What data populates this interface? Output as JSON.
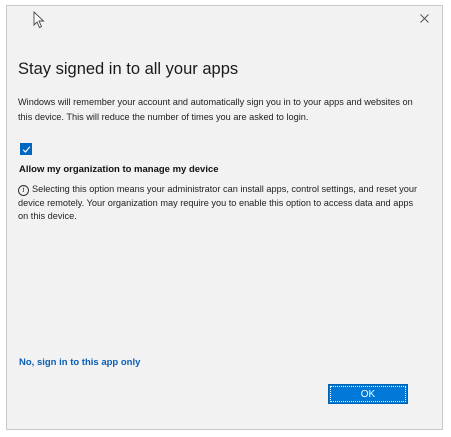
{
  "dialog": {
    "title": "Stay signed in to all your apps",
    "description": "Windows will remember your account and automatically sign you in to your apps and websites on this device. This will reduce the number of times you are asked to login.",
    "checkbox": {
      "checked": true,
      "label": "Allow my organization to manage my device"
    },
    "info_text": "Selecting this option means your administrator can install apps, control settings, and reset your device remotely. Your organization may require you to enable this option to access data and apps on this device.",
    "alt_link": "No, sign in to this app only",
    "ok_label": "OK",
    "close_icon": "close-icon",
    "info_icon": "info-icon"
  },
  "colors": {
    "accent": "#0078d7",
    "link": "#0a5fb4",
    "background": "#f2f2f2"
  }
}
